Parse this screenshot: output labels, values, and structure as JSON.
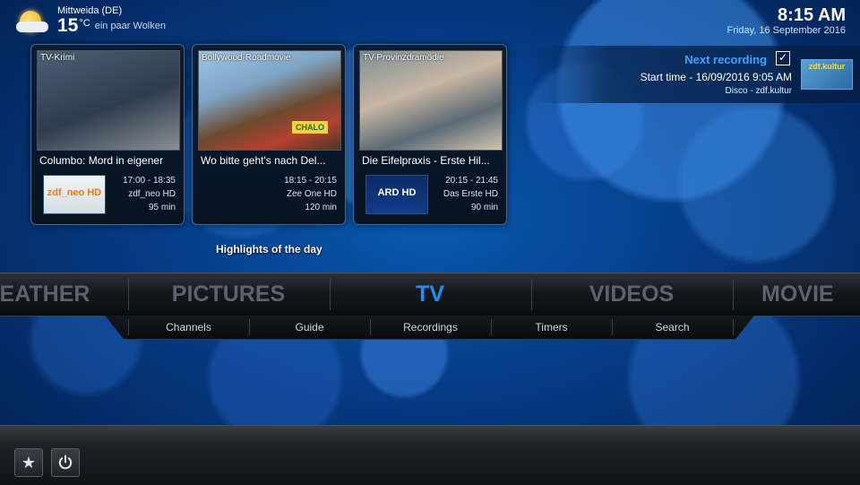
{
  "weather": {
    "location": "Mittweida (DE)",
    "temperature": "15",
    "unit": "°C",
    "condition": "ein paar Wolken",
    "icon": "partly-cloudy-icon"
  },
  "clock": {
    "time": "8:15 AM",
    "date": "Friday, 16 September 2016"
  },
  "next_recording": {
    "title": "Next recording",
    "start": "Start time - 16/09/2016 9:05 AM",
    "channel": "Disco - zdf.kultur",
    "logo_text": "zdf.kultur"
  },
  "cards": [
    {
      "genre": "TV-Krimi",
      "title": "Columbo: Mord in eigener",
      "time": "17:00 - 18:35",
      "channel": "zdf_neo HD",
      "duration": "95 min",
      "logo_text": "zdf_neo HD"
    },
    {
      "genre": "Bollywood-Roadmovie",
      "title": "Wo bitte geht's nach Del...",
      "time": "18:15 - 20:15",
      "channel": "Zee One HD",
      "duration": "120 min",
      "thumb_text": "CHALO"
    },
    {
      "genre": "TV-Provinzdramödie",
      "title": "Die Eifelpraxis - Erste Hil...",
      "time": "20:15 - 21:45",
      "channel": "Das Erste HD",
      "duration": "90 min",
      "logo_text": "ARD HD"
    }
  ],
  "highlights_label": "Highlights of the day",
  "main_menu": [
    "EATHER",
    "PICTURES",
    "TV",
    "VIDEOS",
    "MOVIE"
  ],
  "sub_menu": [
    "Channels",
    "Guide",
    "Recordings",
    "Timers",
    "Search"
  ],
  "bottom_buttons": [
    "favourites-star-icon",
    "power-icon"
  ],
  "colors": {
    "accent": "#1f8df3",
    "next_recording_title": "#3da4ff"
  }
}
